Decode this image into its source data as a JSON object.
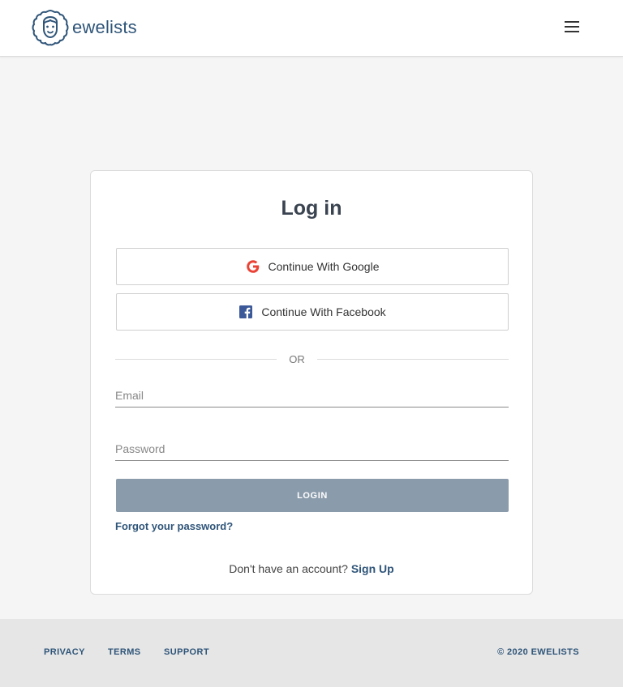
{
  "header": {
    "brand": "ewelists",
    "logo_icon": "sheep-logo-icon",
    "menu_icon": "hamburger-menu-icon"
  },
  "login": {
    "title": "Log in",
    "google_label": "Continue With Google",
    "facebook_label": "Continue With Facebook",
    "divider": "OR",
    "email_placeholder": "Email",
    "email_value": "",
    "password_placeholder": "Password",
    "password_value": "",
    "login_button": "LOGIN",
    "forgot_password": "Forgot your password?",
    "no_account_text": "Don't have an account?",
    "signup_link": "Sign Up"
  },
  "footer": {
    "links": [
      "PRIVACY",
      "TERMS",
      "SUPPORT"
    ],
    "copyright": "© 2020 EWELISTS"
  },
  "colors": {
    "brand": "#2f5579",
    "login_button_bg": "#8a9bab",
    "google_red": "#ea4335",
    "facebook_blue": "#3b5998",
    "page_bg": "#f5f5f5",
    "footer_bg": "#e6e6e6"
  }
}
